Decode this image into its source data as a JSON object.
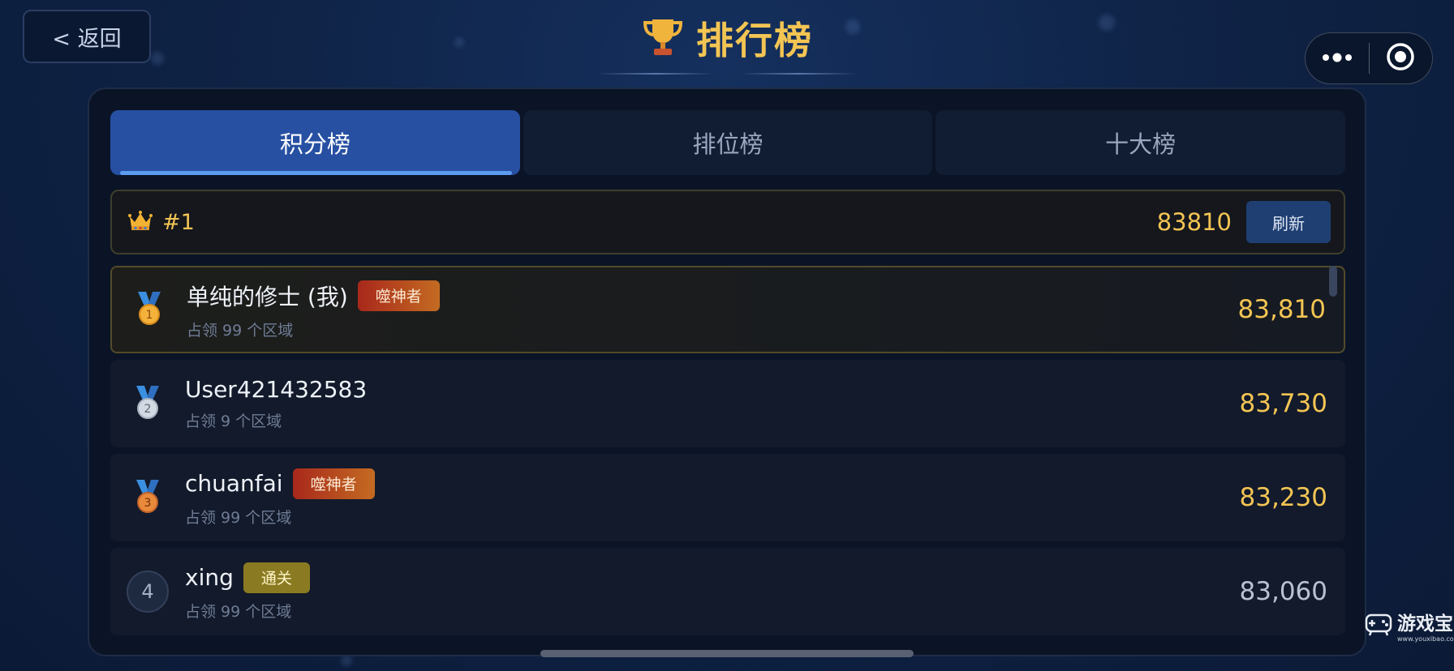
{
  "header": {
    "back_label": "< 返回",
    "title": "排行榜",
    "trophy_icon": "trophy-icon",
    "menu_icon": "more-dots-icon",
    "close_icon": "target-circle-icon"
  },
  "tabs": [
    {
      "label": "积分榜",
      "active": true
    },
    {
      "label": "排位榜",
      "active": false
    },
    {
      "label": "十大榜",
      "active": false
    }
  ],
  "my_rank": {
    "icon": "crown-icon",
    "rank": "#1",
    "score": "83810",
    "refresh_label": "刷新"
  },
  "rows": [
    {
      "rank": "1",
      "medal": "gold-medal-icon",
      "name": "单纯的修士 (我)",
      "tag": "噬神者",
      "sub": "占领 99 个区域",
      "score": "83,810"
    },
    {
      "rank": "2",
      "medal": "silver-medal-icon",
      "name": "User421432583",
      "tag": "",
      "sub": "占领 9 个区域",
      "score": "83,730"
    },
    {
      "rank": "3",
      "medal": "bronze-medal-icon",
      "name": "chuanfai",
      "tag": "噬神者",
      "sub": "占领 99 个区域",
      "score": "83,230"
    },
    {
      "rank": "4",
      "medal": "",
      "name": "xing",
      "tag": "通关",
      "sub": "占领 99 个区域",
      "score": "83,060"
    }
  ],
  "watermark": {
    "text": "游戏宝",
    "url_text": "www.youxibao.com"
  },
  "colors": {
    "accent_gold": "#f3c553",
    "tab_active": "#2750a3",
    "tag_red": "#a8281b",
    "tag_olive": "#8a7b22"
  }
}
